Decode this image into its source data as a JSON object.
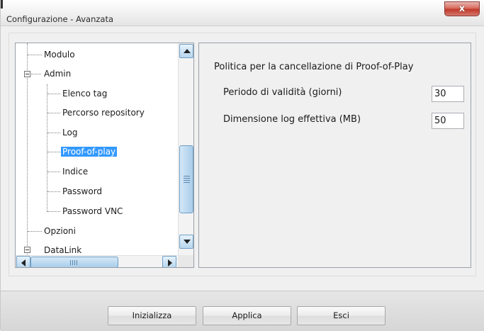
{
  "window": {
    "title": "Configurazione - Avanzata",
    "close_label": "x"
  },
  "tree": {
    "items": [
      {
        "label": "Modulo"
      },
      {
        "label": "Admin"
      },
      {
        "label": "Elenco tag"
      },
      {
        "label": "Percorso repository"
      },
      {
        "label": "Log"
      },
      {
        "label": "Proof-of-play",
        "selected": true
      },
      {
        "label": "Indice"
      },
      {
        "label": "Password"
      },
      {
        "label": "Password VNC"
      },
      {
        "label": "Opzioni"
      },
      {
        "label": "DataLink"
      }
    ]
  },
  "panel": {
    "title": "Politica per la cancellazione di Proof-of-Play",
    "fields": [
      {
        "label": "Periodo di validità (giorni)",
        "value": "30"
      },
      {
        "label": "Dimensione log effettiva (MB)",
        "value": "50"
      }
    ]
  },
  "buttons": {
    "initialize": "Inizializza",
    "apply": "Applica",
    "exit": "Esci"
  },
  "colors": {
    "selection": "#3399ff",
    "close_button": "#c0392b"
  }
}
